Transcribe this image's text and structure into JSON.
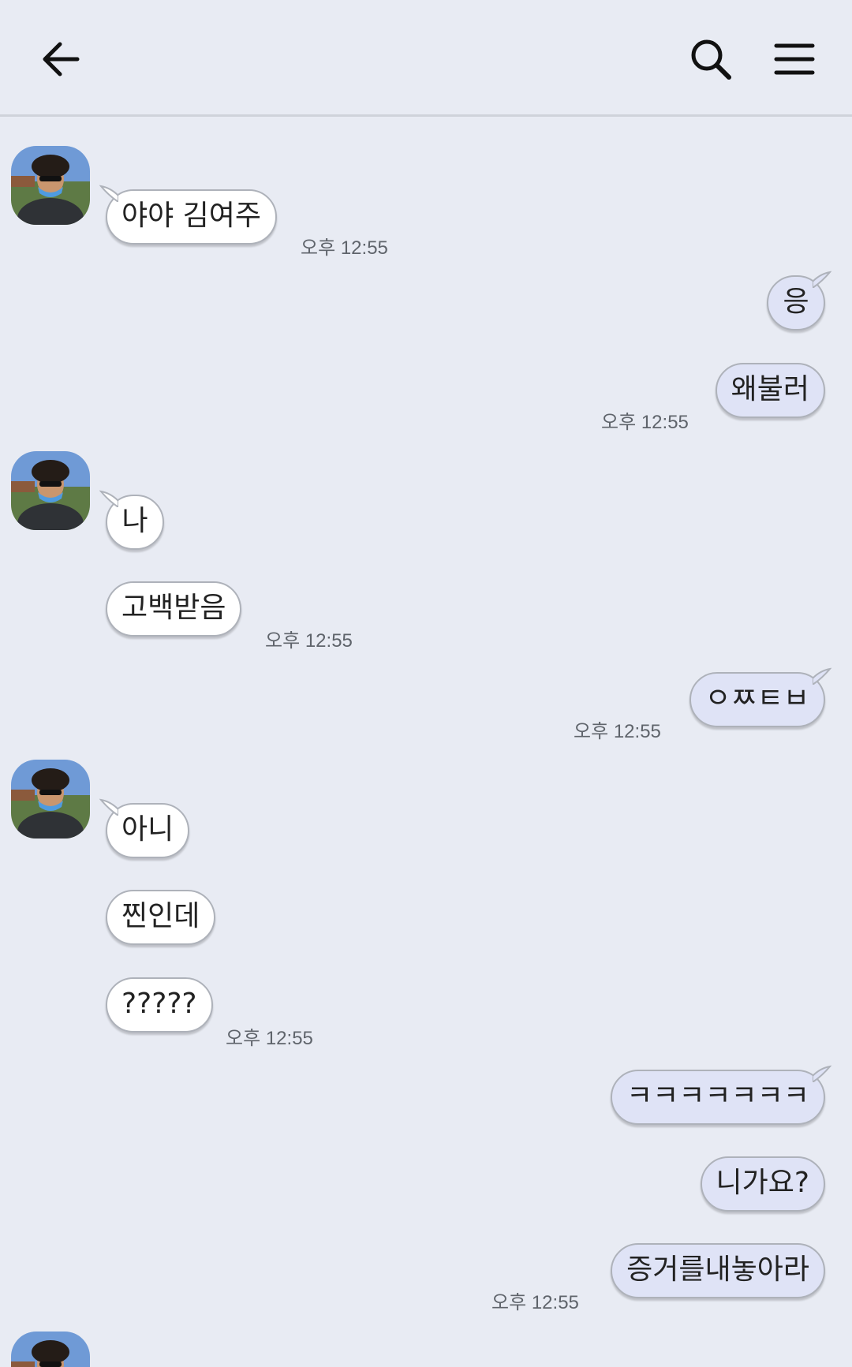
{
  "header": {
    "back_icon": "arrow-left-icon",
    "search_icon": "search-icon",
    "menu_icon": "hamburger-menu-icon"
  },
  "colors": {
    "background": "#e8ebf3",
    "incoming_bubble": "#ffffff",
    "outgoing_bubble": "#dfe3f6",
    "bubble_border": "#aeb2ba",
    "timestamp": "#5f646b"
  },
  "messages": [
    {
      "side": "in",
      "text": "야야 김여주"
    },
    {
      "side": "in",
      "time": "오후 12:55"
    },
    {
      "side": "out",
      "text": "응"
    },
    {
      "side": "out",
      "text": "왜불러"
    },
    {
      "side": "out",
      "time": "오후 12:55"
    },
    {
      "side": "in",
      "text": "나"
    },
    {
      "side": "in",
      "text": "고백받음"
    },
    {
      "side": "in",
      "time": "오후 12:55"
    },
    {
      "side": "out",
      "text": "ㅇㅉㅌㅂ"
    },
    {
      "side": "out",
      "time": "오후 12:55"
    },
    {
      "side": "in",
      "text": "아니"
    },
    {
      "side": "in",
      "text": "찐인데"
    },
    {
      "side": "in",
      "text": "?????"
    },
    {
      "side": "in",
      "time": "오후 12:55"
    },
    {
      "side": "out",
      "text": "ㅋㅋㅋㅋㅋㅋㅋ"
    },
    {
      "side": "out",
      "text": "니가요?"
    },
    {
      "side": "out",
      "text": "증거를내놓아라"
    },
    {
      "side": "out",
      "time": "오후 12:55"
    }
  ]
}
